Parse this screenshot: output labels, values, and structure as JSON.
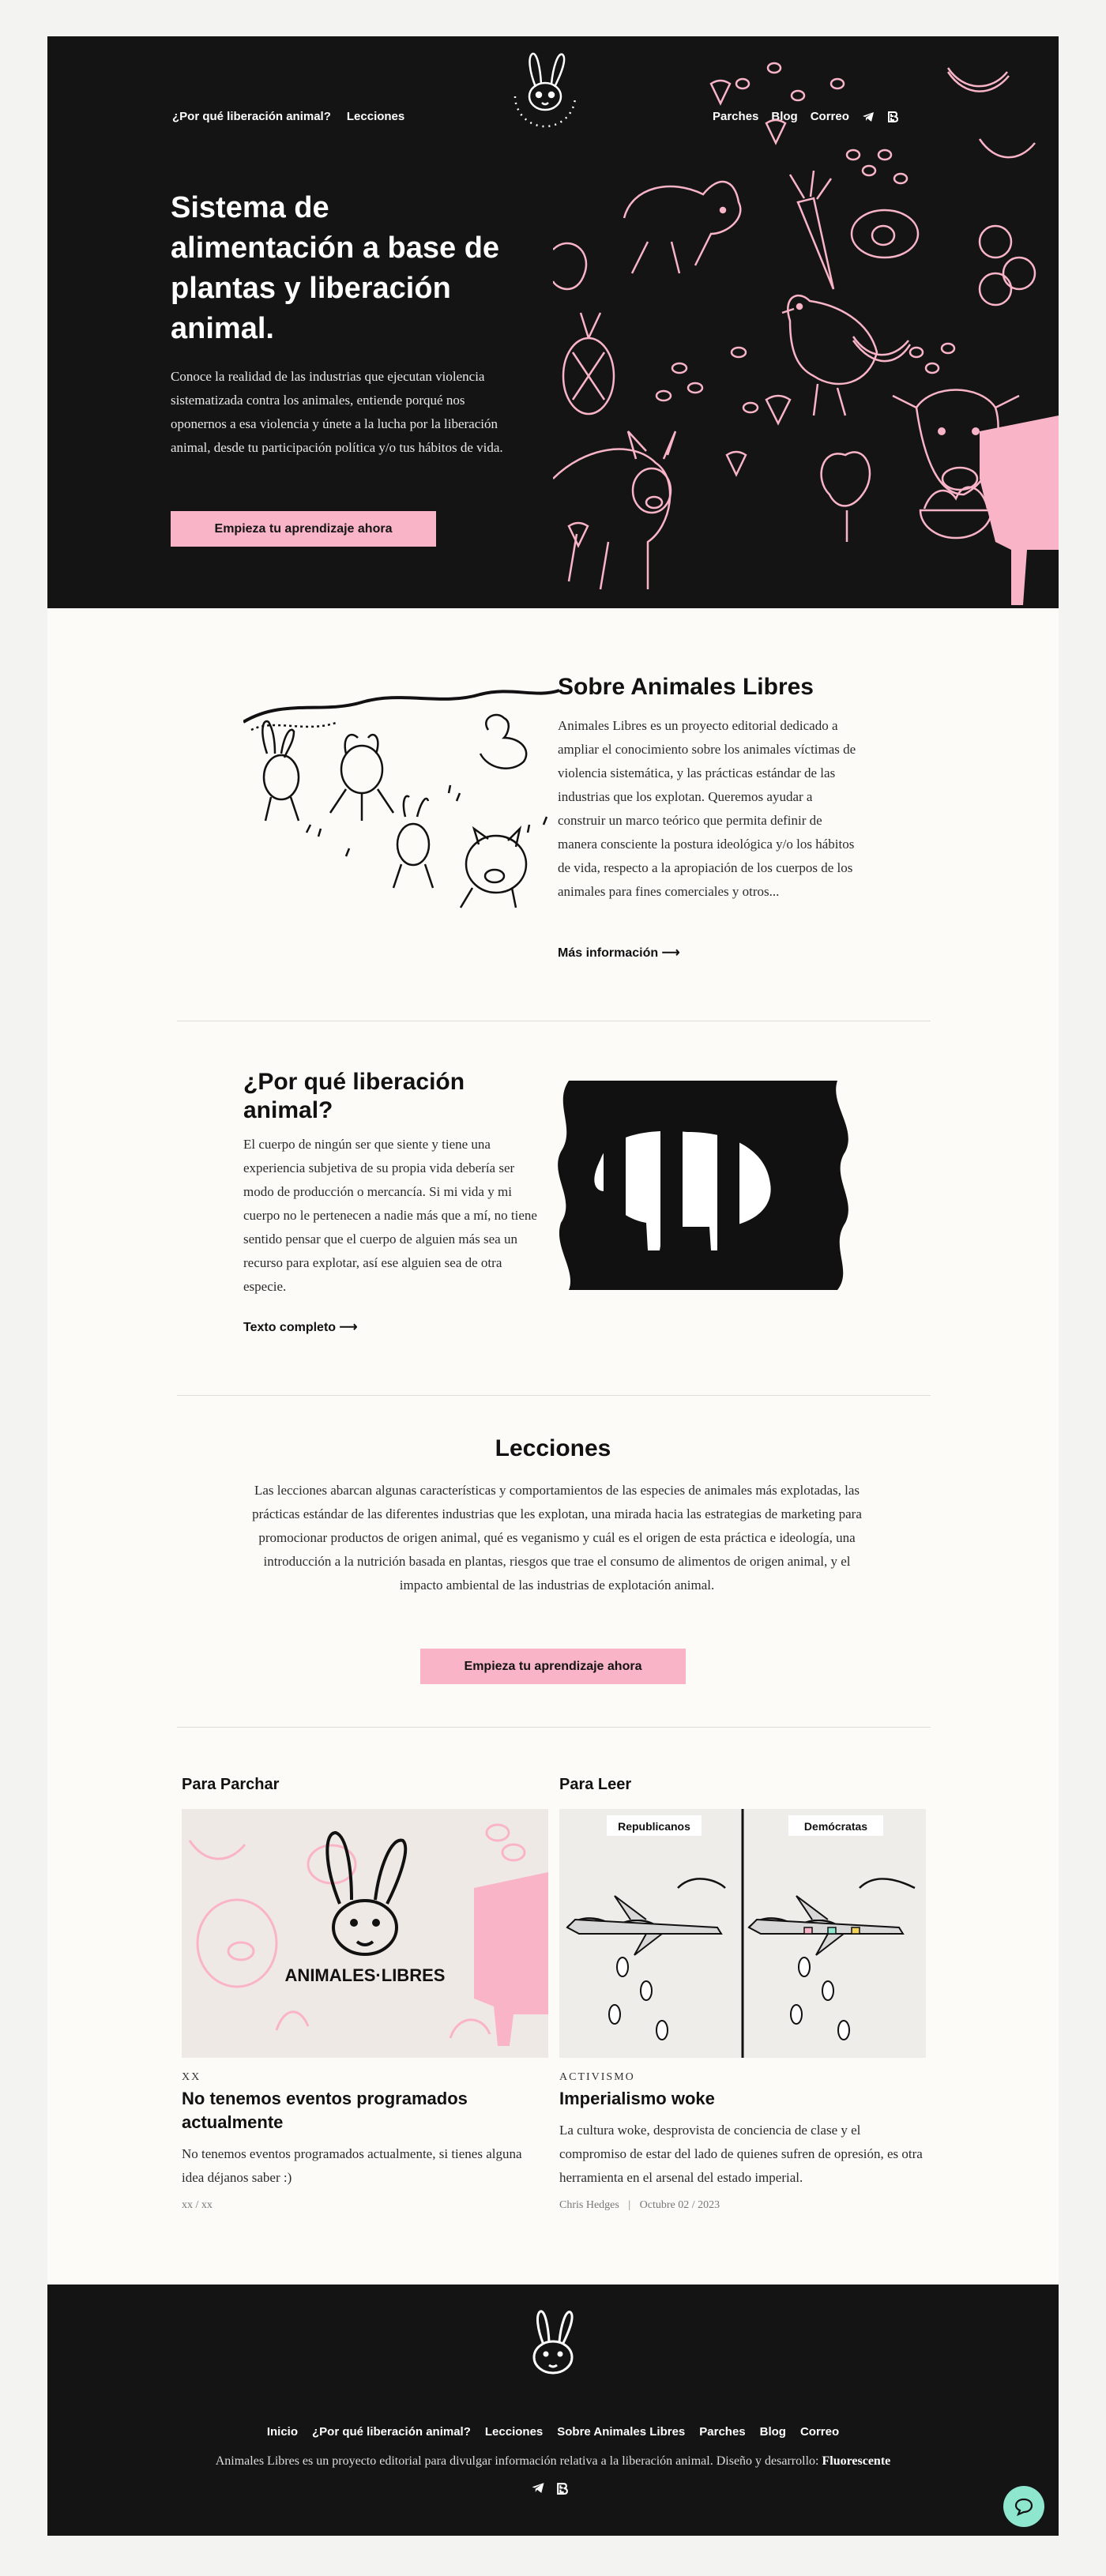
{
  "nav": {
    "left": [
      "¿Por qué liberación animal?",
      "Lecciones"
    ],
    "right": [
      "Parches",
      "Blog",
      "Correo"
    ],
    "icons": [
      "telegram-icon",
      "bitcoin-icon"
    ]
  },
  "hero": {
    "title": "Sistema de alimentación a base de plantas y liberación animal.",
    "text": "Conoce la realidad de las industrias que ejecutan violencia sistematizada contra los animales, entiende porqué nos oponernos a esa violencia y únete a la lucha por la liberación animal, desde tu participación política y/o tus hábitos de vida.",
    "button": "Empieza tu aprendizaje ahora"
  },
  "logo": {
    "text": "ANIMALES·LIBRES"
  },
  "about": {
    "title": "Sobre Animales Libres",
    "text": "Animales Libres es un proyecto editorial dedicado a ampliar el conocimiento sobre los animales víctimas de violencia sistemática, y las prácticas estándar de las industrias que los explotan. Queremos ayudar a construir un marco teórico que permita definir de manera consciente la postura ideológica y/o los hábitos de vida, respecto a la apropiación de los cuerpos de los animales para fines comerciales y otros...",
    "more": "Más información ⟶"
  },
  "why": {
    "title": "¿Por qué liberación animal?",
    "text": "El cuerpo de ningún ser que siente y tiene una experiencia subjetiva de su propia vida debería ser modo de producción o mercancía. Si mi vida y mi cuerpo no le pertenecen a nadie más que a mí, no tiene sentido pensar que el cuerpo de alguien más sea un recurso para explotar, así ese alguien sea de otra especie.",
    "more": "Texto completo ⟶"
  },
  "lessons": {
    "title": "Lecciones",
    "text": "Las lecciones abarcan algunas características y comportamientos de las especies de animales más explotadas, las prácticas estándar de las diferentes industrias que les explotan, una mirada hacia las estrategias de marketing para promocionar productos de origen animal, qué es veganismo y cuál es el origen de esta práctica e ideología, una introducción a la nutrición basada en plantas, riesgos que trae el consumo de alimentos de origen animal, y el impacto ambiental de las industrias de explotación animal.",
    "button": "Empieza tu aprendizaje ahora"
  },
  "cards": [
    {
      "column": "Para Parchar",
      "tag": "XX",
      "title": "No tenemos eventos programados actualmente",
      "text": "No tenemos eventos programados actualmente, si tienes alguna idea déjanos saber :)",
      "meta": "xx / xx"
    },
    {
      "column": "Para Leer",
      "tag": "ACTIVISMO",
      "title": "Imperialismo woke",
      "text": "La cultura woke, desprovista de conciencia de clase y el compromiso de estar del lado de quienes sufren de opresión, es otra herramienta en el arsenal del estado imperial.",
      "author": "Chris Hedges",
      "date": "Octubre 02 / 2023",
      "labels": [
        "Republicanos",
        "Demócratas"
      ]
    }
  ],
  "footer": {
    "nav": [
      "Inicio",
      "¿Por qué liberación animal?",
      "Lecciones",
      "Sobre Animales Libres",
      "Parches",
      "Blog",
      "Correo"
    ],
    "text": "Animales Libres es un proyecto editorial para divulgar información relativa a la liberación animal. Diseño y desarrollo:",
    "credit": "Fluorescente"
  },
  "colors": {
    "accent": "#f9b4c8",
    "dark": "#141414",
    "page": "#fcfbf8",
    "chat": "#8ee6cf"
  }
}
